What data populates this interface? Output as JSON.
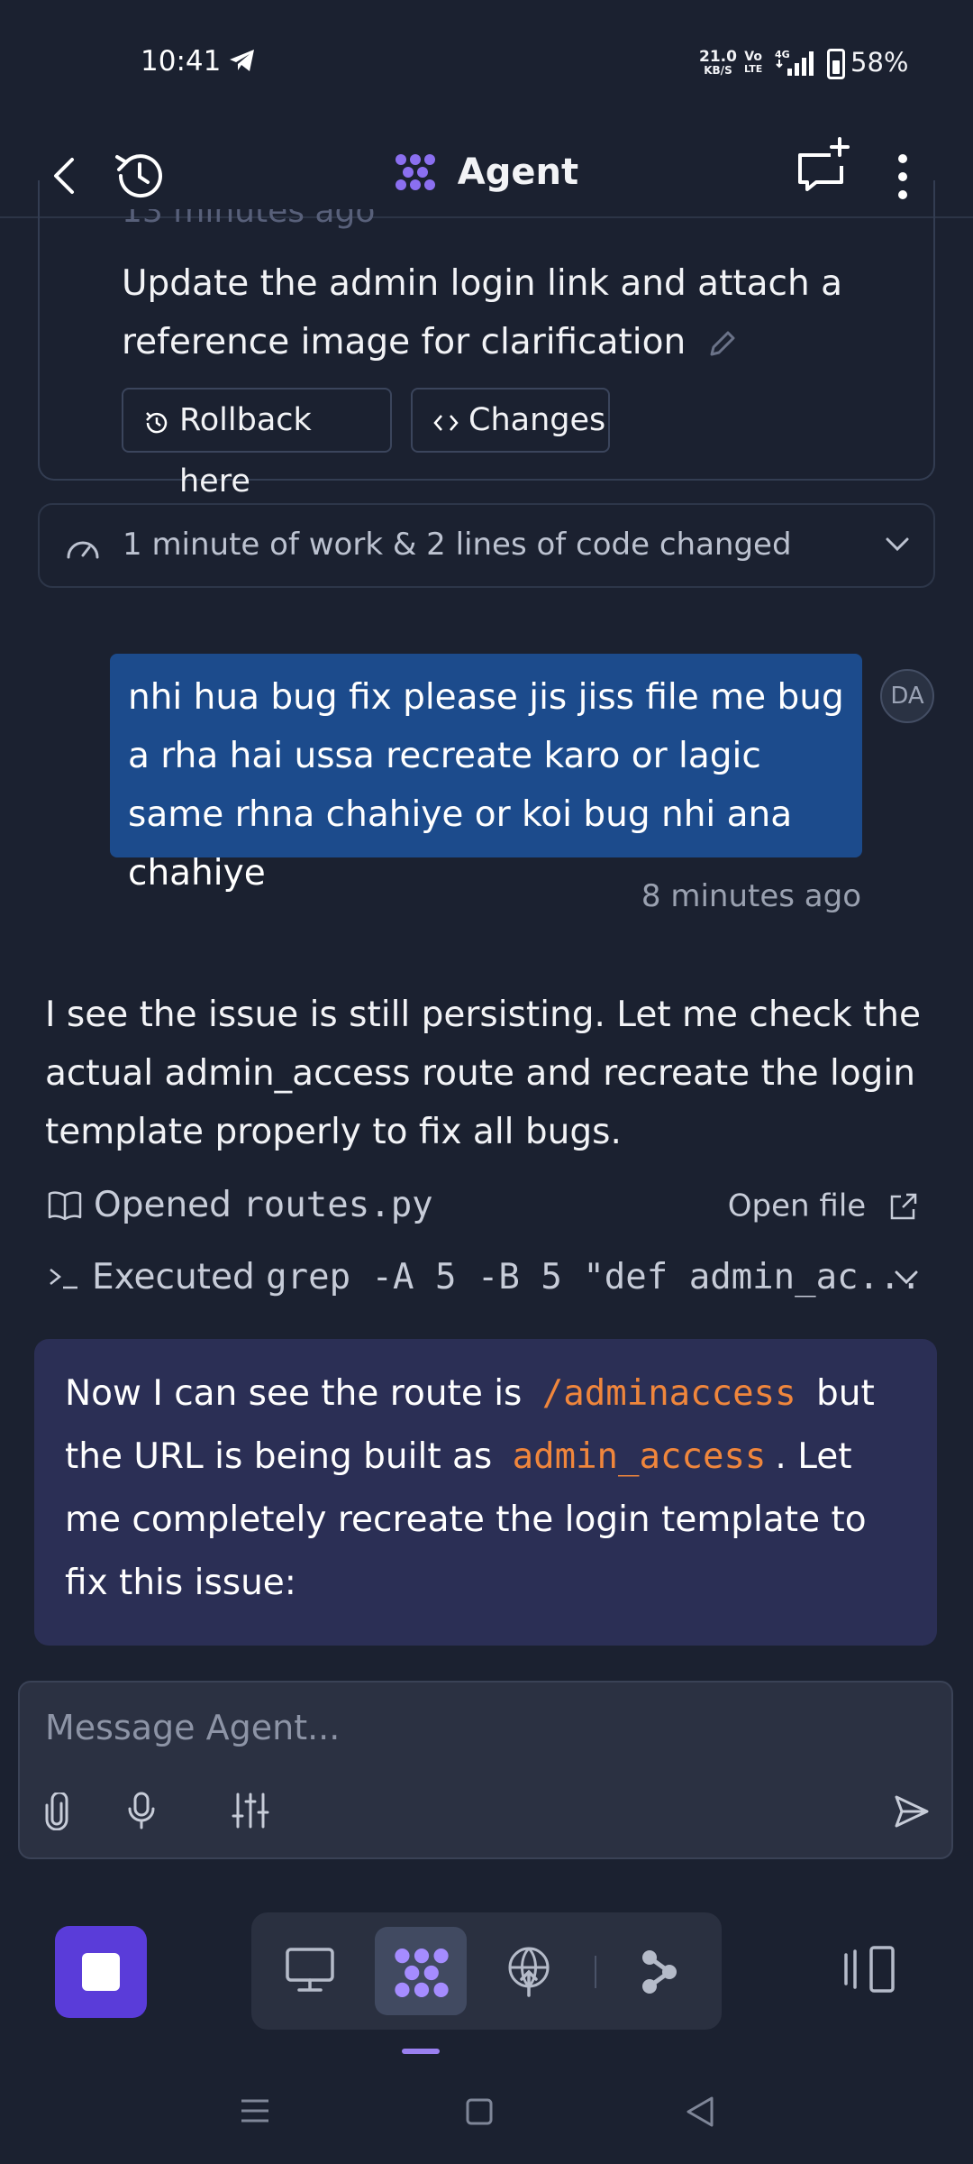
{
  "status_bar": {
    "time": "10:41",
    "net_speed_value": "21.0",
    "net_speed_unit": "KB/S",
    "volte_top": "Vo",
    "volte_bottom": "LTE",
    "network": "4G",
    "battery": "58%"
  },
  "header": {
    "title": "Agent"
  },
  "previous_checkpoint": {
    "time_ago": "13 minutes ago",
    "message": "Update the admin login link and attach a reference image for clarification",
    "rollback_label": "Rollback here",
    "changes_label": "Changes"
  },
  "work_summary": "1 minute of work & 2 lines of code changed",
  "user_message": {
    "text": "nhi hua bug fix please jis jiss file me bug a rha hai ussa recreate karo or lagic same rhna chahiye or koi bug nhi ana chahiye",
    "avatar_initials": "DA",
    "time_ago": "8 minutes ago"
  },
  "agent_message": {
    "text": "I see the issue is still persisting. Let me check the actual admin_access route and recreate the login template properly to fix all bugs.",
    "opened_prefix": "Opened",
    "opened_file": "routes.py",
    "open_file_label": "Open file",
    "executed_prefix": "Executed",
    "executed_command": "grep -A 5 -B 5 \"def admin_ac...",
    "highlight": {
      "part1": "Now I can see the route is",
      "code1": "/adminaccess",
      "part2": "but the URL is being built as",
      "code2": "admin_access",
      "part3": ". Let me completely recreate the login template to fix this issue:"
    }
  },
  "composer": {
    "placeholder": "Message Agent..."
  },
  "colors": {
    "background": "#1b2130",
    "user_bubble": "#1c4b8c",
    "accent_purple": "#5a3cd9",
    "highlight_card": "#2b2f55",
    "code_orange": "#f0863c"
  }
}
